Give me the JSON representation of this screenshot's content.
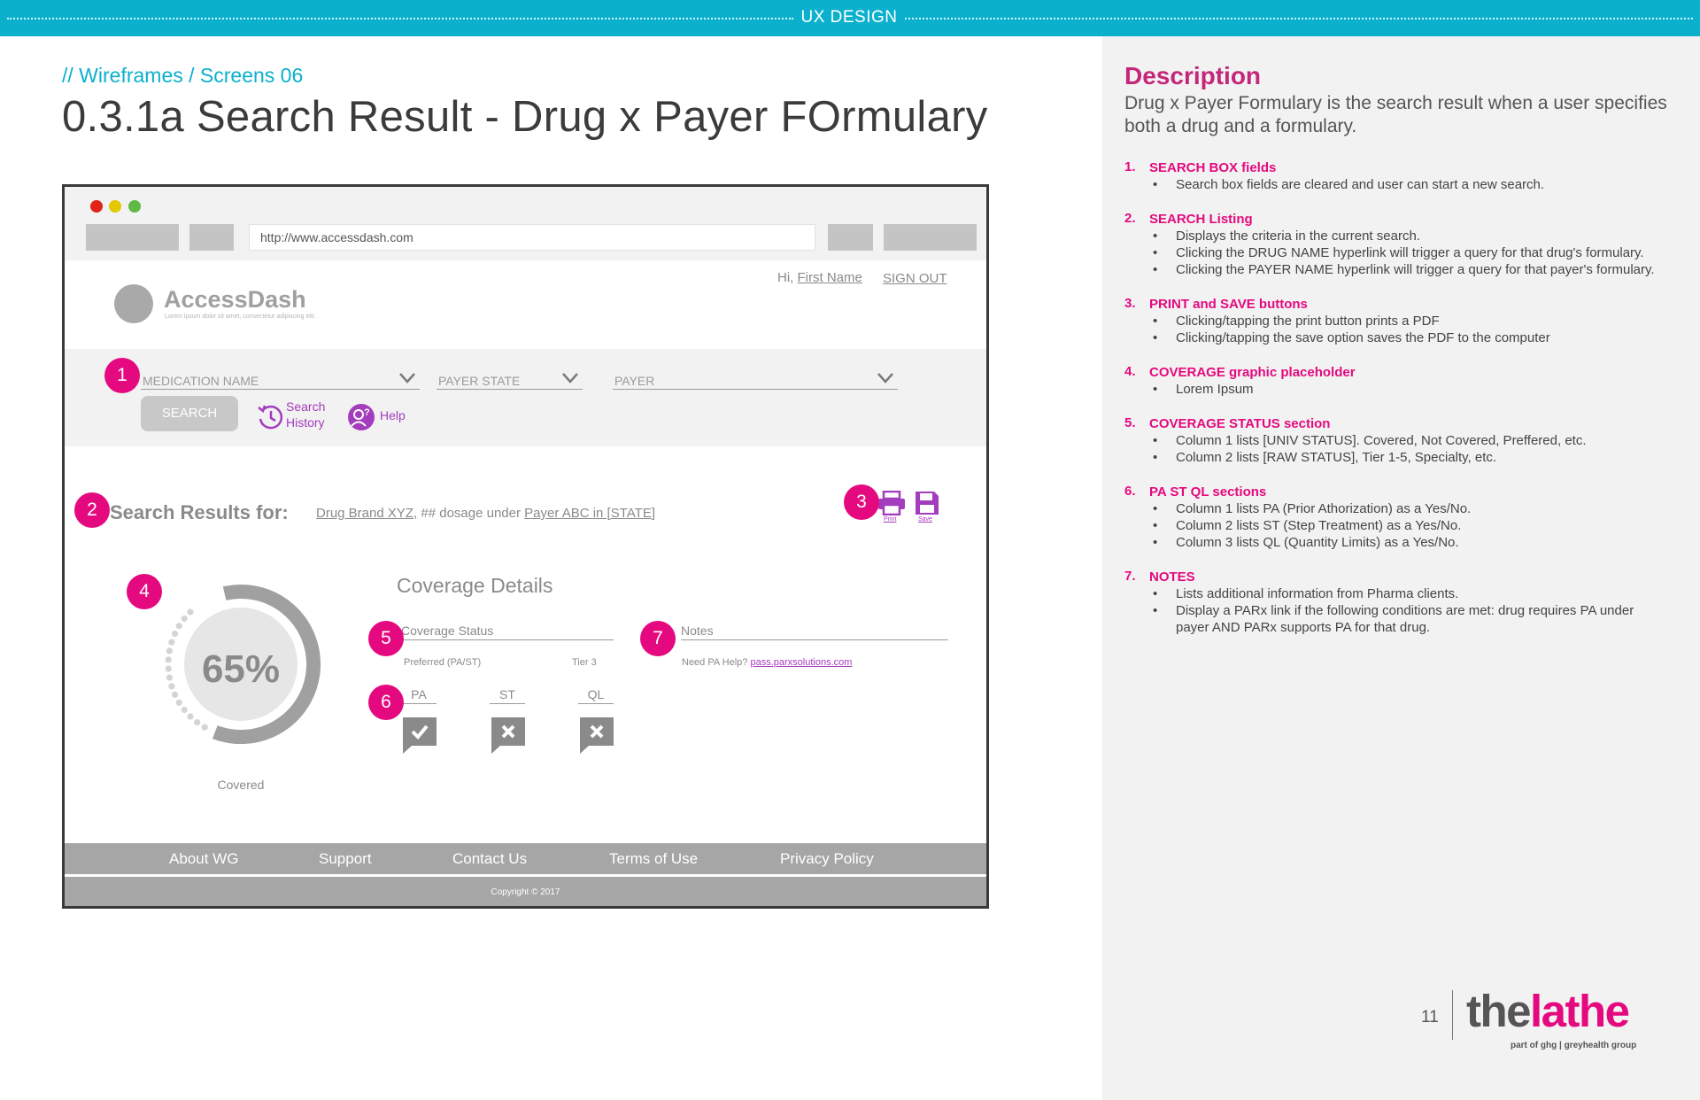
{
  "header": {
    "label": "UX DESIGN"
  },
  "breadcrumb": "// Wireframes  / Screens 06",
  "page_title": "0.3.1a Search Result - Drug x Payer FOrmulary",
  "colors": {
    "teal": "#0bb0cd",
    "magenta": "#e5097f",
    "purple": "#a33cbd",
    "heading_pink": "#c4277a"
  },
  "wireframe": {
    "url": "http://www.accessdash.com",
    "logo_name": "AccessDash",
    "logo_tagline": "Lorem ipsum dolor sit amet, consectetur adipiscing elit.",
    "greeting_prefix": "Hi,",
    "greeting_name": "First Name",
    "sign_out": "SIGN OUT",
    "search": {
      "medication_placeholder": "MEDICATION NAME",
      "payer_state_placeholder": "PAYER STATE",
      "payer_placeholder": "PAYER",
      "search_button": "SEARCH",
      "history_line1": "Search",
      "history_line2": "History",
      "help": "Help"
    },
    "results": {
      "label": "Search Results for:",
      "drug_link": "Drug Brand XYZ,",
      "dosage_text": "## dosage under",
      "payer_link": "Payer ABC in [STATE]",
      "print_label": "Print",
      "save_label": "Save"
    },
    "coverage": {
      "percent_label": "65%",
      "percent_value": 65,
      "status_caption": "Covered",
      "details_title": "Coverage Details",
      "status_header": "Coverage Status",
      "status_col1": "Preferred (PA/ST)",
      "status_col2": "Tier 3",
      "notes_header": "Notes",
      "notes_prompt": "Need PA Help?",
      "notes_link": "pass.parxsolutions.com",
      "pa": "PA",
      "st": "ST",
      "ql": "QL",
      "pa_value": "check",
      "st_value": "x",
      "ql_value": "x"
    },
    "badges": [
      "1",
      "2",
      "3",
      "4",
      "5",
      "6",
      "7"
    ],
    "footer": {
      "links": [
        "About WG",
        "Support",
        "Contact Us",
        "Terms of Use",
        "Privacy Policy"
      ],
      "copyright": "Copyright © 2017"
    }
  },
  "description": {
    "heading": "Description",
    "intro": "Drug x Payer Formulary is the search result when a user specifies both a drug and a formulary.",
    "items": [
      {
        "num": "1.",
        "title": "SEARCH BOX fields",
        "bullets": [
          "Search box fields are cleared and user can start a new search."
        ]
      },
      {
        "num": "2.",
        "title": "SEARCH Listing",
        "bullets": [
          "Displays the criteria in the current search.",
          "Clicking the DRUG NAME hyperlink will trigger a query for that drug's formulary.",
          "Clicking the PAYER NAME hyperlink will trigger a query for that payer's formulary."
        ]
      },
      {
        "num": "3.",
        "title": "PRINT and SAVE buttons",
        "bullets": [
          "Clicking/tapping the print button prints a PDF",
          "Clicking/tapping the save option saves the PDF to the computer"
        ]
      },
      {
        "num": "4.",
        "title": "COVERAGE graphic placeholder",
        "bullets": [
          "Lorem Ipsum"
        ]
      },
      {
        "num": "5.",
        "title": "COVERAGE STATUS section",
        "bullets": [
          "Column 1 lists [UNIV STATUS]. Covered, Not Covered, Preffered, etc.",
          "Column 2 lists [RAW STATUS], Tier 1-5, Specialty, etc."
        ]
      },
      {
        "num": "6.",
        "title": "PA ST QL sections",
        "bullets": [
          "Column 1 lists PA (Prior Athorization) as a Yes/No.",
          "Column 2 lists ST (Step Treatment) as a Yes/No.",
          "Column 3 lists QL (Quantity Limits) as a Yes/No."
        ]
      },
      {
        "num": "7.",
        "title": "NOTES",
        "bullets": [
          "Lists additional information from Pharma clients.",
          "Display a PARx link if the following conditions are met: drug requires PA under payer AND PARx supports PA for that drug."
        ]
      }
    ]
  },
  "page_number": "11",
  "brand": {
    "part1": "the",
    "part2": "lathe",
    "sub": "part of ghg | greyhealth group"
  }
}
